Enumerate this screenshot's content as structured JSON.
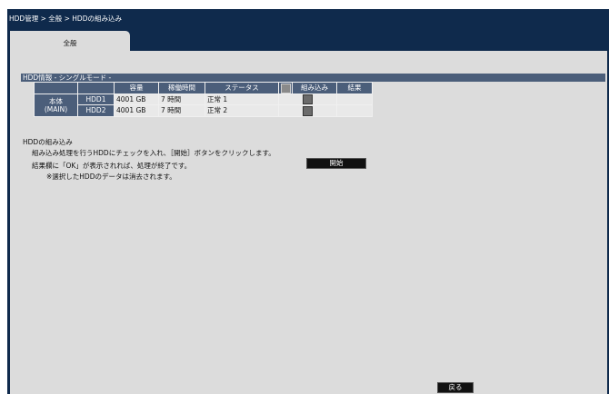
{
  "breadcrumb": "HDD管理 > 全般 > HDDの組み込み",
  "tab": {
    "label": "全般"
  },
  "section": {
    "title": "HDD情報 - シングルモード -"
  },
  "table": {
    "headers": {
      "capacity": "容量",
      "uptime": "稼働時間",
      "status": "ステータス",
      "incorporate": "組み込み",
      "result": "結果"
    },
    "group_label_line1": "本体",
    "group_label_line2": "(MAIN)",
    "rows": [
      {
        "name": "HDD1",
        "capacity": "4001 GB",
        "uptime": "7 時間",
        "status": "正常 1",
        "checked": false,
        "result": ""
      },
      {
        "name": "HDD2",
        "capacity": "4001 GB",
        "uptime": "7 時間",
        "status": "正常 2",
        "checked": false,
        "result": ""
      }
    ]
  },
  "instructions": {
    "title": "HDDの組み込み",
    "line1": "組み込み処理を行うHDDにチェックを入れ、［開始］ボタンをクリックします。",
    "line2": "結果欄に「OK」が表示されれば、処理が終了です。",
    "line3": "※選択したHDDのデータは消去されます。"
  },
  "buttons": {
    "start": "開始",
    "back": "戻る"
  },
  "colors": {
    "frame": "#0f2a4c",
    "panel": "#dcdcdc",
    "header": "#4b5e7a"
  }
}
